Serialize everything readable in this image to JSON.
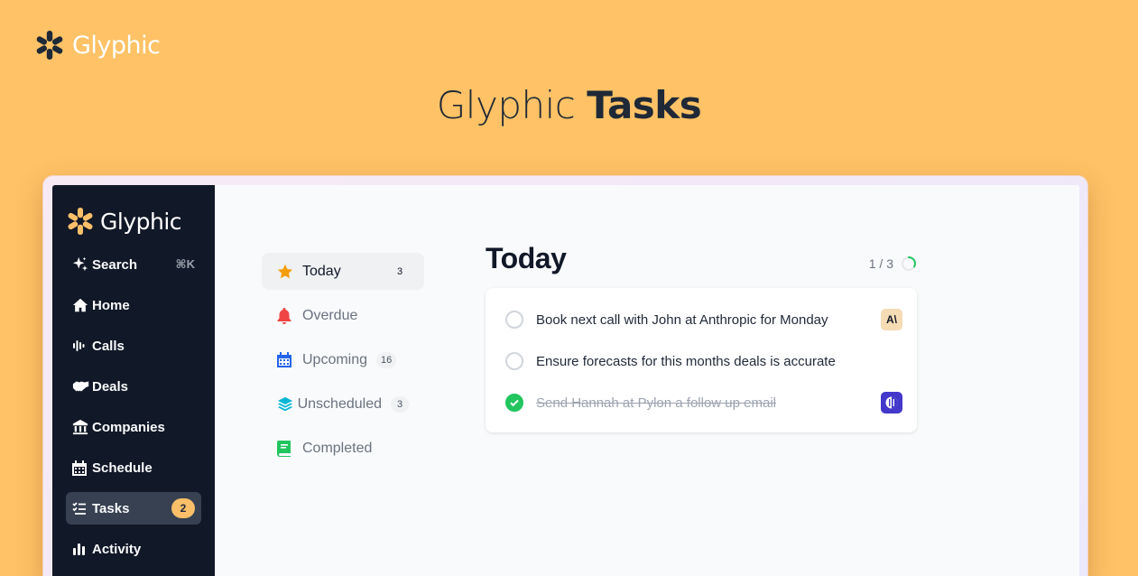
{
  "brand": {
    "name": "Glyphic"
  },
  "hero": {
    "title_light": "Glyphic",
    "title_bold": "Tasks"
  },
  "sidebar": {
    "brand": "Glyphic",
    "items": [
      {
        "label": "Search",
        "icon": "sparkles-icon",
        "shortcut": "⌘K"
      },
      {
        "label": "Home",
        "icon": "home-icon"
      },
      {
        "label": "Calls",
        "icon": "waveform-icon"
      },
      {
        "label": "Deals",
        "icon": "handshake-icon"
      },
      {
        "label": "Companies",
        "icon": "bank-icon"
      },
      {
        "label": "Schedule",
        "icon": "calendar-icon"
      },
      {
        "label": "Tasks",
        "icon": "task-list-icon",
        "badge": "2",
        "active": true
      },
      {
        "label": "Activity",
        "icon": "bar-chart-icon"
      }
    ]
  },
  "filters": [
    {
      "label": "Today",
      "count": "3",
      "icon": "star-icon",
      "active": true
    },
    {
      "label": "Overdue",
      "icon": "bell-icon"
    },
    {
      "label": "Upcoming",
      "count": "16",
      "icon": "calendar-icon"
    },
    {
      "label": "Unscheduled",
      "count": "3",
      "icon": "stack-icon"
    },
    {
      "label": "Completed",
      "icon": "book-icon"
    }
  ],
  "content": {
    "title": "Today",
    "progress_text": "1 / 3",
    "progress_fraction": 0.33,
    "tasks": [
      {
        "text": "Book next call with John at Anthropic for Monday",
        "done": false,
        "company": "Anthropic",
        "tag_text": "A\\"
      },
      {
        "text": "Ensure forecasts for this months deals is accurate",
        "done": false
      },
      {
        "text": "Send Hannah at Pylon a follow up email",
        "done": true,
        "company": "Pylon"
      }
    ]
  },
  "colors": {
    "background": "#ffc266",
    "sidebar": "#111827",
    "accent_orange": "#fbbf6a",
    "success": "#22c55e",
    "star": "#f59e0b",
    "bell": "#ef4444",
    "calendar": "#2563eb",
    "stack": "#06b6d4",
    "book": "#22c55e"
  }
}
